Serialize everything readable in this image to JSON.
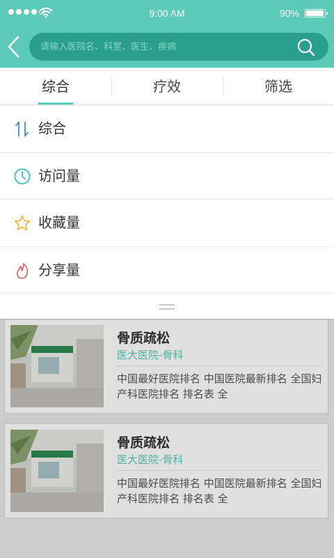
{
  "status_bar": {
    "time": "9:00 AM",
    "battery_text": "90%",
    "battery_level": 0.9,
    "signal_bars": 4,
    "signal_max": 5
  },
  "header": {
    "search_placeholder": "请输入医院名、科室、医生、疾病",
    "icons": {
      "back": "chevron-left-icon",
      "search": "search-icon"
    },
    "colors": {
      "bar": "#5ccab9",
      "search_field": "#2a9f8d"
    }
  },
  "tabs": [
    {
      "label": "综合",
      "active": true
    },
    {
      "label": "疗效",
      "active": false
    },
    {
      "label": "筛选",
      "active": false
    }
  ],
  "sort_menu": {
    "items": [
      {
        "label": "综合",
        "icon": "sort-arrows-icon",
        "color": "#3b8fd9"
      },
      {
        "label": "访问量",
        "icon": "clock-icon",
        "color": "#33c2b4"
      },
      {
        "label": "收藏量",
        "icon": "star-icon",
        "color": "#f0b42d"
      },
      {
        "label": "分享量",
        "icon": "fire-icon",
        "color": "#ee5a5a"
      }
    ],
    "collapse_icon": "drag-handle-icon"
  },
  "list": {
    "items": [
      {
        "title": "骨质疏松",
        "hospital": "医大医院-骨科",
        "desc": "中国最好医院排名 中国医院最新排名 全国妇产科医院排名 排名表 全"
      },
      {
        "title": "骨质疏松",
        "hospital": "医大医院-骨科",
        "desc": "中国最好医院排名 中国医院最新排名 全国妇产科医院排名 排名表 全"
      }
    ]
  }
}
